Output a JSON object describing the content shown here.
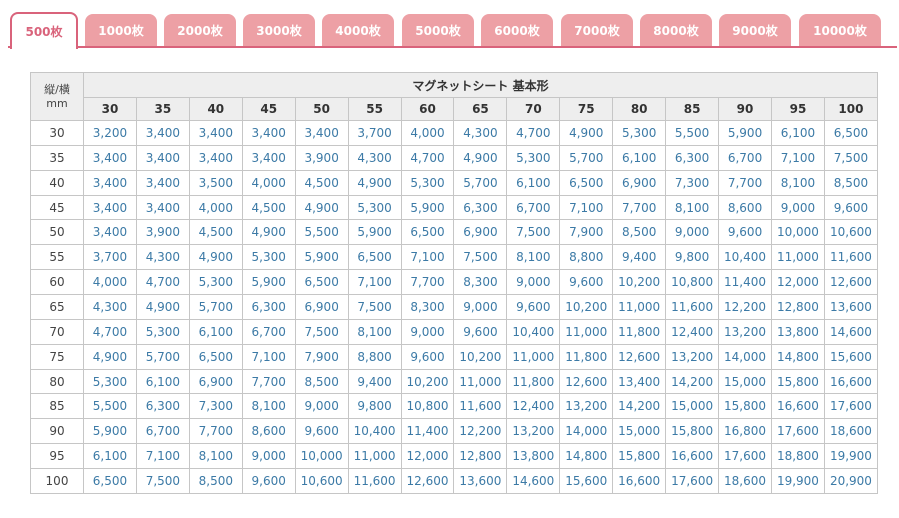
{
  "tabs": [
    {
      "label": "500枚",
      "active": true
    },
    {
      "label": "1000枚",
      "active": false
    },
    {
      "label": "2000枚",
      "active": false
    },
    {
      "label": "3000枚",
      "active": false
    },
    {
      "label": "4000枚",
      "active": false
    },
    {
      "label": "5000枚",
      "active": false
    },
    {
      "label": "6000枚",
      "active": false
    },
    {
      "label": "7000枚",
      "active": false
    },
    {
      "label": "8000枚",
      "active": false
    },
    {
      "label": "9000枚",
      "active": false
    },
    {
      "label": "10000枚",
      "active": false
    }
  ],
  "colors": {
    "accent": "#d9637b",
    "tab_inactive": "#eda0a5",
    "price_text": "#3c7aa6",
    "header_bg": "#eeeeee",
    "border": "#c6c6c6"
  },
  "table": {
    "corner_line1": "縦/横",
    "corner_line2": "mm",
    "group_title": "マグネットシート 基本形",
    "columns": [
      "30",
      "35",
      "40",
      "45",
      "50",
      "55",
      "60",
      "65",
      "70",
      "75",
      "80",
      "85",
      "90",
      "95",
      "100"
    ],
    "rows": [
      {
        "label": "30",
        "values": [
          "3,200",
          "3,400",
          "3,400",
          "3,400",
          "3,400",
          "3,700",
          "4,000",
          "4,300",
          "4,700",
          "4,900",
          "5,300",
          "5,500",
          "5,900",
          "6,100",
          "6,500"
        ]
      },
      {
        "label": "35",
        "values": [
          "3,400",
          "3,400",
          "3,400",
          "3,400",
          "3,900",
          "4,300",
          "4,700",
          "4,900",
          "5,300",
          "5,700",
          "6,100",
          "6,300",
          "6,700",
          "7,100",
          "7,500"
        ]
      },
      {
        "label": "40",
        "values": [
          "3,400",
          "3,400",
          "3,500",
          "4,000",
          "4,500",
          "4,900",
          "5,300",
          "5,700",
          "6,100",
          "6,500",
          "6,900",
          "7,300",
          "7,700",
          "8,100",
          "8,500"
        ]
      },
      {
        "label": "45",
        "values": [
          "3,400",
          "3,400",
          "4,000",
          "4,500",
          "4,900",
          "5,300",
          "5,900",
          "6,300",
          "6,700",
          "7,100",
          "7,700",
          "8,100",
          "8,600",
          "9,000",
          "9,600"
        ]
      },
      {
        "label": "50",
        "values": [
          "3,400",
          "3,900",
          "4,500",
          "4,900",
          "5,500",
          "5,900",
          "6,500",
          "6,900",
          "7,500",
          "7,900",
          "8,500",
          "9,000",
          "9,600",
          "10,000",
          "10,600"
        ]
      },
      {
        "label": "55",
        "values": [
          "3,700",
          "4,300",
          "4,900",
          "5,300",
          "5,900",
          "6,500",
          "7,100",
          "7,500",
          "8,100",
          "8,800",
          "9,400",
          "9,800",
          "10,400",
          "11,000",
          "11,600"
        ]
      },
      {
        "label": "60",
        "values": [
          "4,000",
          "4,700",
          "5,300",
          "5,900",
          "6,500",
          "7,100",
          "7,700",
          "8,300",
          "9,000",
          "9,600",
          "10,200",
          "10,800",
          "11,400",
          "12,000",
          "12,600"
        ]
      },
      {
        "label": "65",
        "values": [
          "4,300",
          "4,900",
          "5,700",
          "6,300",
          "6,900",
          "7,500",
          "8,300",
          "9,000",
          "9,600",
          "10,200",
          "11,000",
          "11,600",
          "12,200",
          "12,800",
          "13,600"
        ]
      },
      {
        "label": "70",
        "values": [
          "4,700",
          "5,300",
          "6,100",
          "6,700",
          "7,500",
          "8,100",
          "9,000",
          "9,600",
          "10,400",
          "11,000",
          "11,800",
          "12,400",
          "13,200",
          "13,800",
          "14,600"
        ]
      },
      {
        "label": "75",
        "values": [
          "4,900",
          "5,700",
          "6,500",
          "7,100",
          "7,900",
          "8,800",
          "9,600",
          "10,200",
          "11,000",
          "11,800",
          "12,600",
          "13,200",
          "14,000",
          "14,800",
          "15,600"
        ]
      },
      {
        "label": "80",
        "values": [
          "5,300",
          "6,100",
          "6,900",
          "7,700",
          "8,500",
          "9,400",
          "10,200",
          "11,000",
          "11,800",
          "12,600",
          "13,400",
          "14,200",
          "15,000",
          "15,800",
          "16,600"
        ]
      },
      {
        "label": "85",
        "values": [
          "5,500",
          "6,300",
          "7,300",
          "8,100",
          "9,000",
          "9,800",
          "10,800",
          "11,600",
          "12,400",
          "13,200",
          "14,200",
          "15,000",
          "15,800",
          "16,600",
          "17,600"
        ]
      },
      {
        "label": "90",
        "values": [
          "5,900",
          "6,700",
          "7,700",
          "8,600",
          "9,600",
          "10,400",
          "11,400",
          "12,200",
          "13,200",
          "14,000",
          "15,000",
          "15,800",
          "16,800",
          "17,600",
          "18,600"
        ]
      },
      {
        "label": "95",
        "values": [
          "6,100",
          "7,100",
          "8,100",
          "9,000",
          "10,000",
          "11,000",
          "12,000",
          "12,800",
          "13,800",
          "14,800",
          "15,800",
          "16,600",
          "17,600",
          "18,800",
          "19,900"
        ]
      },
      {
        "label": "100",
        "values": [
          "6,500",
          "7,500",
          "8,500",
          "9,600",
          "10,600",
          "11,600",
          "12,600",
          "13,600",
          "14,600",
          "15,600",
          "16,600",
          "17,600",
          "18,600",
          "19,900",
          "20,900"
        ]
      }
    ]
  }
}
